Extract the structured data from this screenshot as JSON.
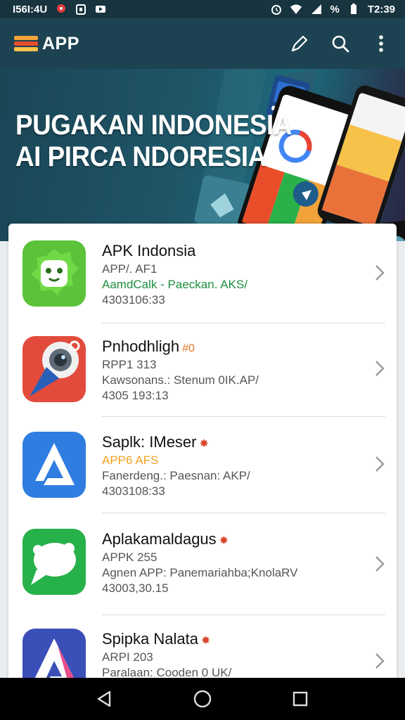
{
  "status_bar": {
    "left_text": "I56I:4U",
    "right_text": "T2:39",
    "battery_text": "%",
    "icons": [
      "pin-icon",
      "lock-icon",
      "youtube-icon",
      "alarm-icon",
      "wifi-icon",
      "signal-icon",
      "battery-icon"
    ]
  },
  "app_bar": {
    "title": "APP",
    "actions": [
      "edit-icon",
      "search-icon",
      "more-vert-icon"
    ]
  },
  "hero": {
    "line1": "PUGAKAN INDONESIA",
    "line2": "AI PIRCA NDORESIA"
  },
  "apps": [
    {
      "name": "APK Indonsia",
      "mark": "",
      "line2": "APP/. AF1",
      "line2_color": "#555555",
      "line3": "AamdCalk - Paeckan. AKS/",
      "line3_color": "#1e8e3e",
      "line4": "4303106:33",
      "icon": "bot-icon"
    },
    {
      "name": "Pnhodhligh",
      "mark": "#0",
      "mark_color": "#e0772b",
      "line2": "RPP1 313",
      "line2_color": "#555555",
      "line3": "Kawsonans.: Stenum 0IK.AP/",
      "line3_color": "#555555",
      "line4": "4305 193:13",
      "icon": "lens-icon"
    },
    {
      "name": "Saplk: IMeser",
      "mark": "✸",
      "mark_color": "#d9462b",
      "line2": "APP6 AFS",
      "line2_color": "#f0a020",
      "line3": "Fanerdeng.: Paesnan: AKP/",
      "line3_color": "#555555",
      "line4": "4303108:33",
      "icon": "drive-icon"
    },
    {
      "name": "Aplakamaldagus",
      "mark": "✸",
      "mark_color": "#d9462b",
      "line2": "APPK 255",
      "line2_color": "#555555",
      "line3": "Agnen APP: Panemariahba;KnolaRV",
      "line3_color": "#555555",
      "line4": "43003,30.15",
      "icon": "chat-icon"
    },
    {
      "name": "Spipka Nalata",
      "mark": "✸",
      "mark_color": "#d9462b",
      "line2": "ARPI 203",
      "line2_color": "#555555",
      "line3": "Paralaan: Cooden 0 UK/",
      "line3_color": "#555555",
      "line4": "",
      "icon": "arrow-app-icon"
    }
  ],
  "nav": [
    "back-icon",
    "home-icon",
    "recents-icon"
  ]
}
